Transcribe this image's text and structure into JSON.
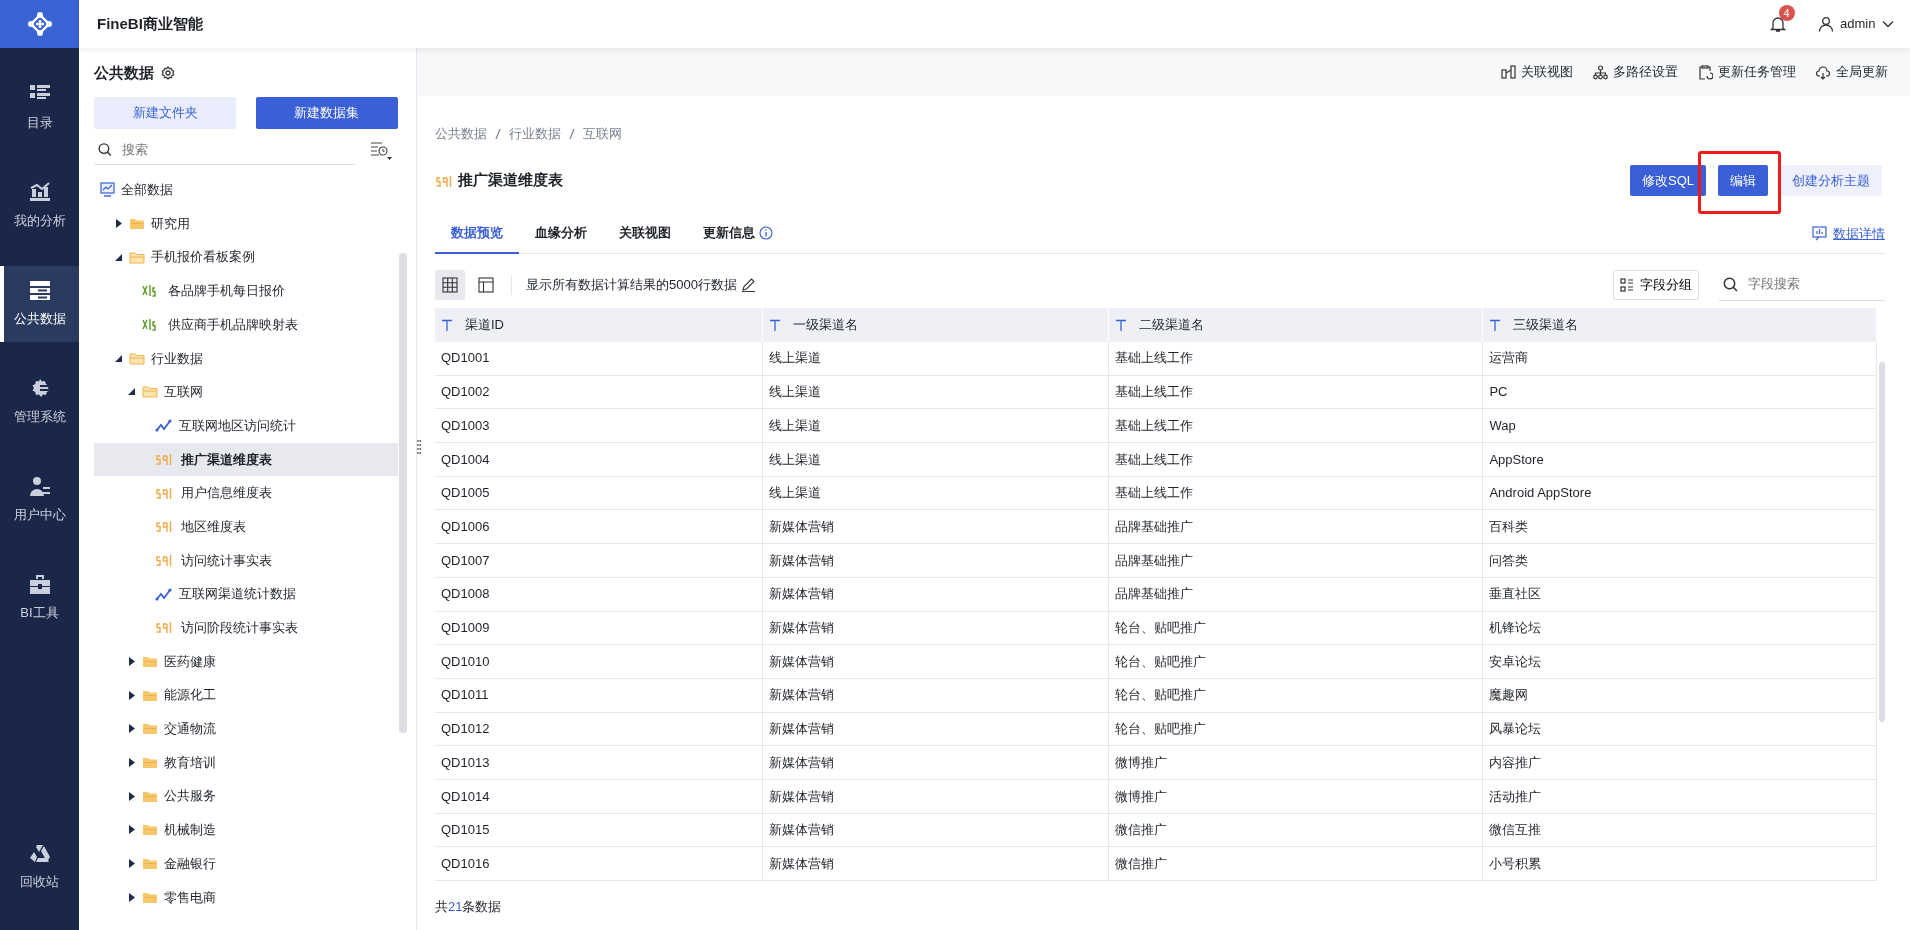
{
  "app": {
    "title": "FineBI商业智能",
    "notifications": "4",
    "user": "admin"
  },
  "rail": [
    {
      "label": "目录",
      "selected": false
    },
    {
      "label": "我的分析",
      "selected": false
    },
    {
      "label": "公共数据",
      "selected": true
    },
    {
      "label": "管理系统",
      "selected": false
    },
    {
      "label": "用户中心",
      "selected": false
    },
    {
      "label": "BI工具",
      "selected": false
    },
    {
      "label": "回收站",
      "selected": false
    }
  ],
  "panel": {
    "title": "公共数据",
    "buttons": [
      {
        "label": "新建文件夹",
        "kind": "secondary"
      },
      {
        "label": "新建数据集",
        "kind": "primary"
      }
    ],
    "search": {
      "placeholder": "搜索"
    },
    "tree": [
      {
        "label": "全部数据",
        "kind": "root",
        "selected": false,
        "children": [
          {
            "label": "研究用",
            "kind": "folder",
            "expanded": false,
            "selected": false
          },
          {
            "label": "手机报价看板案例",
            "kind": "folder",
            "expanded": true,
            "selected": false,
            "children": [
              {
                "label": "各品牌手机每日报价",
                "kind": "xls",
                "selected": false
              },
              {
                "label": "供应商手机品牌映射表",
                "kind": "xls",
                "selected": false
              }
            ]
          },
          {
            "label": "行业数据",
            "kind": "folder",
            "expanded": true,
            "selected": false,
            "children": [
              {
                "label": "互联网",
                "kind": "folder",
                "expanded": true,
                "selected": false,
                "children": [
                  {
                    "label": "互联网地区访问统计",
                    "kind": "line",
                    "selected": false
                  },
                  {
                    "label": "推广渠道维度表",
                    "kind": "sql",
                    "selected": true
                  },
                  {
                    "label": "用户信息维度表",
                    "kind": "sql",
                    "selected": false
                  },
                  {
                    "label": "地区维度表",
                    "kind": "sql",
                    "selected": false
                  },
                  {
                    "label": "访问统计事实表",
                    "kind": "sql",
                    "selected": false
                  },
                  {
                    "label": "互联网渠道统计数据",
                    "kind": "line",
                    "selected": false
                  },
                  {
                    "label": "访问阶段统计事实表",
                    "kind": "sql",
                    "selected": false
                  }
                ]
              },
              {
                "label": "医药健康",
                "kind": "folder",
                "expanded": false,
                "selected": false
              },
              {
                "label": "能源化工",
                "kind": "folder",
                "expanded": false,
                "selected": false
              },
              {
                "label": "交通物流",
                "kind": "folder",
                "expanded": false,
                "selected": false
              },
              {
                "label": "教育培训",
                "kind": "folder",
                "expanded": false,
                "selected": false
              },
              {
                "label": "公共服务",
                "kind": "folder",
                "expanded": false,
                "selected": false
              },
              {
                "label": "机械制造",
                "kind": "folder",
                "expanded": false,
                "selected": false
              },
              {
                "label": "金融银行",
                "kind": "folder",
                "expanded": false,
                "selected": false
              },
              {
                "label": "零售电商",
                "kind": "folder",
                "expanded": false,
                "selected": false
              }
            ]
          }
        ]
      }
    ]
  },
  "toolbar": [
    "关联视图",
    "多路径设置",
    "更新任务管理",
    "全局更新"
  ],
  "breadcrumb": [
    "公共数据",
    "行业数据",
    "互联网"
  ],
  "dataset": {
    "title": "推广渠道维度表",
    "kind": "sql"
  },
  "actions": [
    {
      "label": "修改SQL",
      "kind": "primary",
      "highlighted": false
    },
    {
      "label": "编辑",
      "kind": "primary",
      "highlighted": true
    },
    {
      "label": "创建分析主题",
      "kind": "light",
      "highlighted": false
    }
  ],
  "tabs": [
    {
      "label": "数据预览",
      "selected": true,
      "info": false
    },
    {
      "label": "血缘分析",
      "selected": false,
      "info": false
    },
    {
      "label": "关联视图",
      "selected": false,
      "info": false
    },
    {
      "label": "更新信息",
      "selected": false,
      "info": true
    }
  ],
  "details_link": "数据详情",
  "view_modes": [
    {
      "selected": true
    },
    {
      "selected": false
    }
  ],
  "row_note": "显示所有数据计算结果的5000行数据",
  "field_group": "字段分组",
  "field_search": {
    "placeholder": "字段搜索"
  },
  "table": {
    "columns": [
      "渠道ID",
      "一级渠道名",
      "二级渠道名",
      "三级渠道名"
    ],
    "rows": [
      [
        "QD1001",
        "线上渠道",
        "基础上线工作",
        "运营商"
      ],
      [
        "QD1002",
        "线上渠道",
        "基础上线工作",
        "PC"
      ],
      [
        "QD1003",
        "线上渠道",
        "基础上线工作",
        "Wap"
      ],
      [
        "QD1004",
        "线上渠道",
        "基础上线工作",
        "AppStore"
      ],
      [
        "QD1005",
        "线上渠道",
        "基础上线工作",
        "Android AppStore"
      ],
      [
        "QD1006",
        "新媒体营销",
        "品牌基础推广",
        "百科类"
      ],
      [
        "QD1007",
        "新媒体营销",
        "品牌基础推广",
        "问答类"
      ],
      [
        "QD1008",
        "新媒体营销",
        "品牌基础推广",
        "垂直社区"
      ],
      [
        "QD1009",
        "新媒体营销",
        "轮台、贴吧推广",
        "机锋论坛"
      ],
      [
        "QD1010",
        "新媒体营销",
        "轮台、贴吧推广",
        "安卓论坛"
      ],
      [
        "QD1011",
        "新媒体营销",
        "轮台、贴吧推广",
        "魔趣网"
      ],
      [
        "QD1012",
        "新媒体营销",
        "轮台、贴吧推广",
        "风暴论坛"
      ],
      [
        "QD1013",
        "新媒体营销",
        "微博推广",
        "内容推广"
      ],
      [
        "QD1014",
        "新媒体营销",
        "微博推广",
        "活动推广"
      ],
      [
        "QD1015",
        "新媒体营销",
        "微信推广",
        "微信互推"
      ],
      [
        "QD1016",
        "新媒体营销",
        "微信推广",
        "小号积累"
      ]
    ]
  },
  "total": {
    "prefix": "共",
    "count": "21",
    "suffix": "条数据"
  }
}
